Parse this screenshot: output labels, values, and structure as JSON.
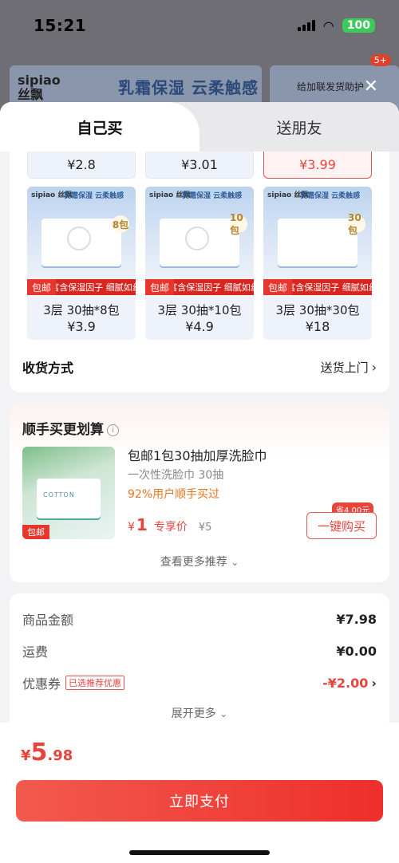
{
  "status": {
    "time": "15:21",
    "battery": "100"
  },
  "background": {
    "logo_en": "sipiao",
    "logo_cn": "丝飘",
    "slogan": "乳霜保湿 云柔触感",
    "pill_text": "给加联发货助护",
    "badge": "5+"
  },
  "tabs": {
    "active": "自己买",
    "other": "送朋友"
  },
  "sku_top": [
    {
      "price": "¥2.8",
      "selected": false
    },
    {
      "price": "¥3.01",
      "selected": false
    },
    {
      "price": "¥3.99",
      "selected": true
    }
  ],
  "skus": [
    {
      "brand": "sipiao 丝飘",
      "slogan": "乳霜保湿 云柔触感",
      "count_badge": "8包",
      "tag": "包邮",
      "feature": "富含保湿因子 细腻如丝",
      "name": "3层 30抽*8包",
      "price": "¥3.9"
    },
    {
      "brand": "sipiao 丝飘",
      "slogan": "乳霜保湿 云柔触感",
      "count_badge": "10包",
      "tag": "包邮",
      "feature": "富含保湿因子 细腻如丝",
      "name": "3层 30抽*10包",
      "price": "¥4.9"
    },
    {
      "brand": "sipiao 丝飘",
      "slogan": "乳霜保湿 云柔触感",
      "count_badge": "30包",
      "tag": "包邮",
      "feature": "富含保湿因子 细腻如丝",
      "name": "3层 30抽*30包",
      "price": "¥18"
    }
  ],
  "shipping": {
    "label": "收货方式",
    "value": "送货上门"
  },
  "addon": {
    "title": "顺手买更划算",
    "product": {
      "title": "包邮1包30抽加厚洗脸巾",
      "subtitle": "一次性洗脸巾 30抽",
      "hot": "92%用户顺手买过",
      "currency": "¥",
      "price": "1",
      "exclusive": "专享价",
      "original": "¥5",
      "save_tag": "省4.00元",
      "buy_label": "一键购买",
      "img_tag": "包邮",
      "img_text": "COTTON"
    },
    "more": "查看更多推荐"
  },
  "summary": {
    "goods_label": "商品金额",
    "goods_value": "¥7.98",
    "freight_label": "运费",
    "freight_value": "¥0.00",
    "coupon_label": "优惠券",
    "coupon_tag": "已选推荐优惠",
    "coupon_value": "-¥2.00",
    "expand": "展开更多"
  },
  "bottom": {
    "currency": "¥",
    "total_int": "5",
    "total_dec": ".98",
    "pay_label": "立即支付"
  },
  "colors": {
    "accent": "#e8443c",
    "pay_button": "#ee2f2c",
    "hot": "#e9751f"
  }
}
